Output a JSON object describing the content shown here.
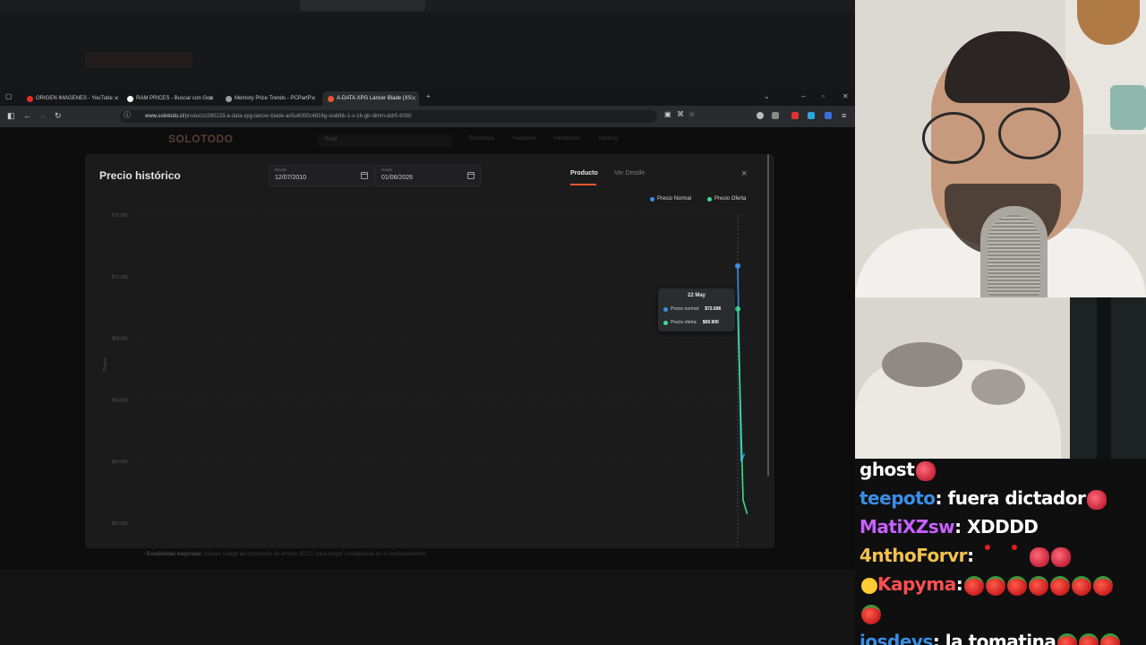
{
  "browser": {
    "tabs": [
      {
        "label": "ORIGEN IMAGENES - YouTube",
        "color": "#e52d27"
      },
      {
        "label": "RAM PRICES - Buscar con Goo",
        "color": "#ffffff"
      },
      {
        "label": "Memory Price Trends - PCPartP",
        "color": "#9c9c9c"
      },
      {
        "label": "A-DATA XPG Lancer Blade (XS",
        "color": "#e8552e"
      }
    ],
    "new_tab": "+",
    "url_host": "www.solotodo.cl",
    "url_path": "/products/260228-a-data-xpg-lancer-blade-ax5u6000c4816g-slablbk-1-x-16-gb-dimm-ddr5-6000"
  },
  "site": {
    "logo": "SOLOTODO",
    "search_value": "RAM",
    "nav": [
      "Tecnología",
      "Hardware",
      "Periféricos",
      "Gaming"
    ]
  },
  "modal": {
    "title": "Precio histórico",
    "from_label": "Desde",
    "from_value": "12/07/2010",
    "to_label": "Hasta",
    "to_value": "01/06/2026",
    "tab_product": "Producto",
    "tab_detail": "Ver Detalle",
    "close": "×",
    "legend_normal": "Precio Normal",
    "legend_offer": "Precio Oferta"
  },
  "tooltip": {
    "date": "22 May",
    "normal_label": "Precio normal:",
    "normal_value": "$72.696",
    "offer_label": "Precio oferta:",
    "offer_value": "$69.900"
  },
  "chart_data": {
    "type": "line",
    "ylabel": "Precio",
    "y_ticks": [
      "$76.000",
      "$72.000",
      "$68.000",
      "$64.000",
      "$60.000",
      "$56.000"
    ],
    "ylim": [
      56000,
      76000
    ],
    "grid": true,
    "legend": "top-right",
    "colors": {
      "normal": "#3b8fe8",
      "offer": "#3ddc97"
    },
    "series": [
      {
        "name": "Precio Normal",
        "points": [
          [
            0.0,
            72696
          ],
          [
            0.25,
            60000
          ],
          [
            0.5,
            60500
          ]
        ]
      },
      {
        "name": "Precio Oferta",
        "points": [
          [
            0.0,
            69900
          ],
          [
            0.4,
            57500
          ],
          [
            0.7,
            56600
          ]
        ]
      }
    ]
  },
  "behind": {
    "line1_bold": "Disipación eficiente:",
    "line1": "incluye disipador de aluminio para mantener temperaturas bajo control durante largas sesiones de uso.",
    "line2_bold": "Estabilidad mejorada:",
    "line2": "Incluye código de corrección de errores (ECC) para mayor confiabilidad en el funcionamiento."
  },
  "chat": [
    {
      "user": "ghost",
      "color": "#ffffff",
      "text": "",
      "emotes": [
        "rasp"
      ]
    },
    {
      "user": "teepoto",
      "color": "#3a8ee6",
      "text": ": fuera dictador",
      "emotes": [
        "rasp"
      ]
    },
    {
      "user": "MatiXZsw",
      "color": "#c660ff",
      "text": ": XDDDD",
      "emotes": []
    },
    {
      "user": "4nthoForvr",
      "color": "#f2c14e",
      "text": ":",
      "emotes": [
        "red",
        "red",
        "rasp",
        "rasp"
      ]
    },
    {
      "user": "Kapyma",
      "color": "#ff4f4f",
      "text": ":",
      "emotes": [
        "tom",
        "tom",
        "tom",
        "tom",
        "tom",
        "tom",
        "tom"
      ]
    },
    {
      "user": "",
      "color": "#ffffff",
      "text": "",
      "emotes": [
        "tom"
      ]
    },
    {
      "user": "josdevs",
      "color": "#3a8ee6",
      "text": ": la tomatina",
      "emotes": [
        "tom",
        "tom",
        "tom"
      ]
    }
  ]
}
